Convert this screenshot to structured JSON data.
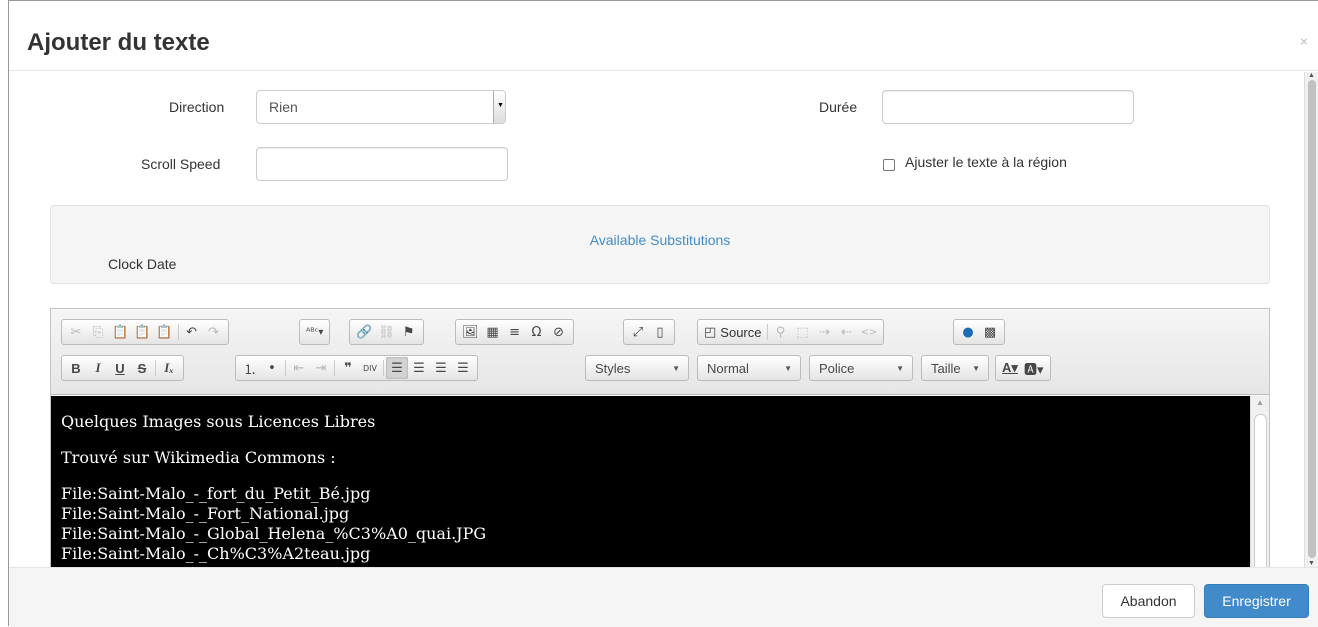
{
  "modal": {
    "title": "Ajouter du texte",
    "close_symbol": "×"
  },
  "form": {
    "direction_label": "Direction",
    "direction_value": "Rien",
    "duration_label": "Durée",
    "duration_value": "",
    "scroll_speed_label": "Scroll Speed",
    "scroll_speed_value": "",
    "fit_text_label": "Ajuster le texte à la région",
    "fit_text_checked": false
  },
  "substitutions": {
    "link": "Available Substitutions",
    "items": [
      "Clock Date"
    ]
  },
  "toolbar": {
    "source_label": "Source",
    "styles_label": "Styles",
    "format_label": "Normal",
    "font_label": "Police",
    "size_label": "Taille"
  },
  "editor_content": {
    "heading": "Quelques Images sous Licences Libres",
    "subheading": "Trouvé sur Wikimedia Commons :",
    "files": [
      "File:Saint-Malo_-_fort_du_Petit_Bé.jpg",
      "File:Saint-Malo_-_Fort_National.jpg",
      "File:Saint-Malo_-_Global_Helena_%C3%A0_quai.JPG",
      "File:Saint-Malo_-_Ch%C3%A2teau.jpg"
    ]
  },
  "footer": {
    "cancel_label": "Abandon",
    "save_label": "Enregistrer"
  },
  "colors": {
    "primary": "#428bca",
    "link": "#428bca",
    "editor_bg": "#000000",
    "editor_text": "#ffffff"
  }
}
